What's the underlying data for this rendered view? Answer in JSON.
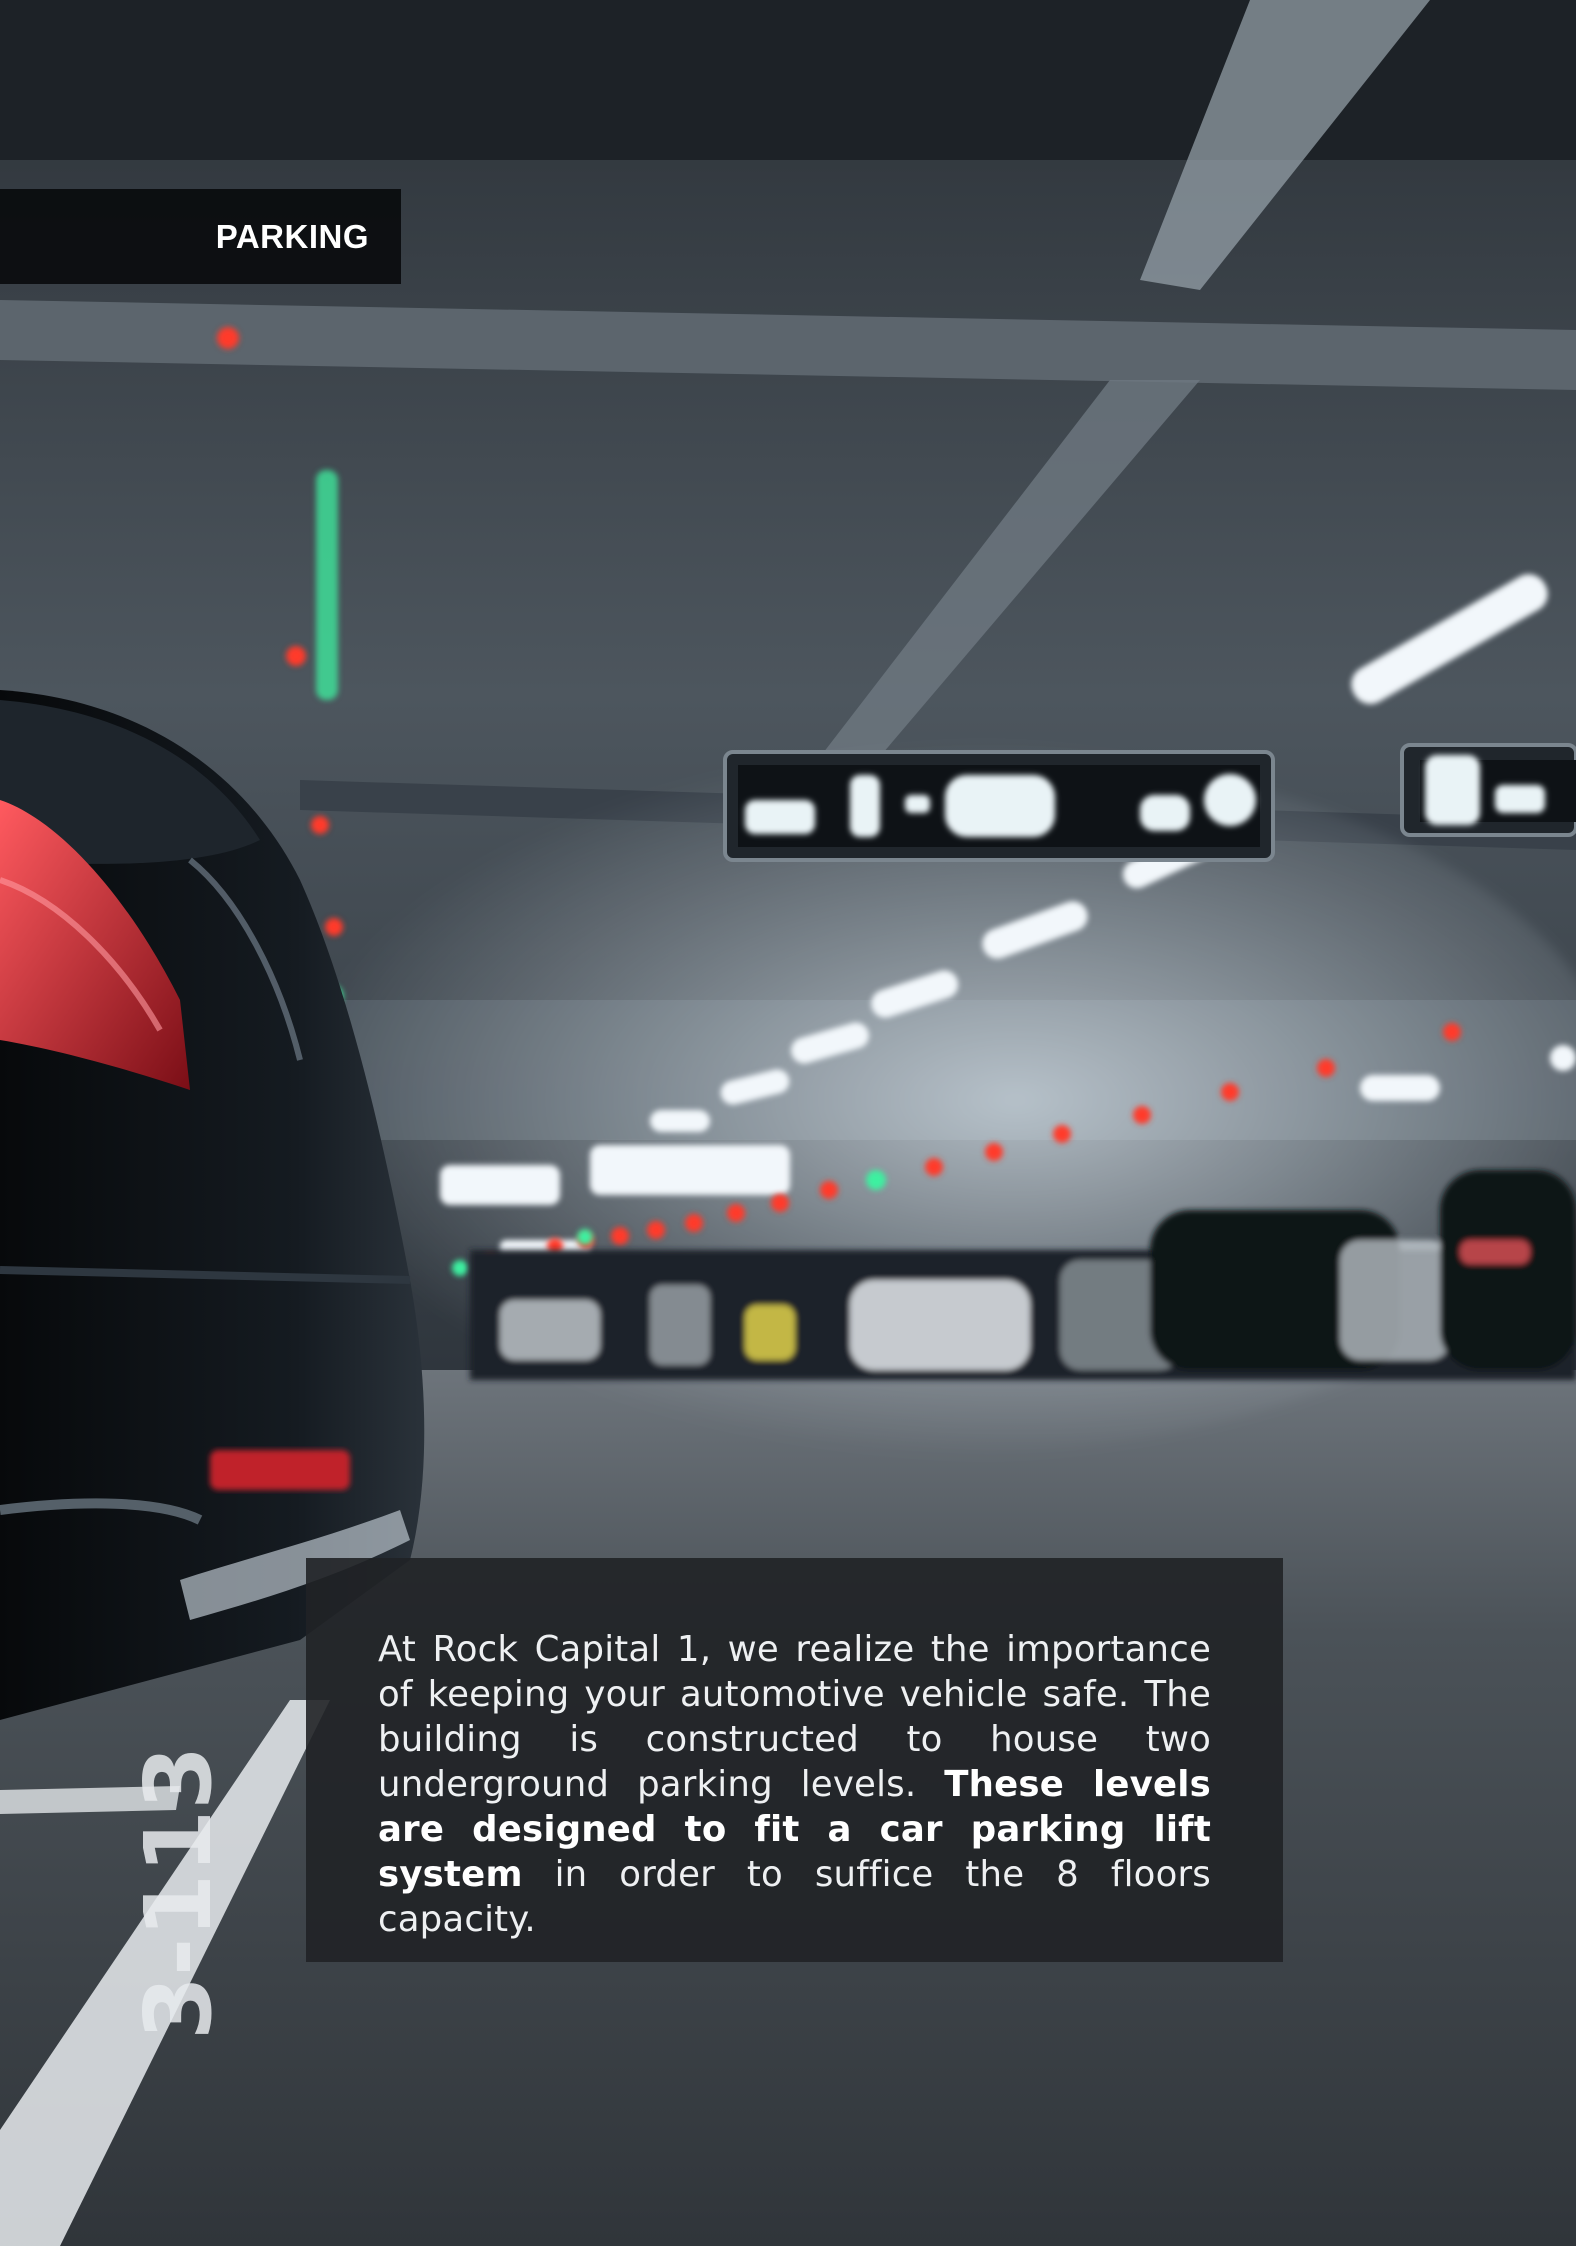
{
  "page": {
    "section_label": "PARKING",
    "body": {
      "lead": "At Rock Capital 1, we realize the importance of keeping your automotive vehicle safe. The building is constructed to house two underground parking levels.",
      "emphasis": "These levels are designed to fit a car parking lift system",
      "tail": "in order to suffice the 8 floors capacity."
    }
  },
  "photo": {
    "subject": "underground parking garage with dark sedan in foreground",
    "floor_marking": "3-113",
    "colors": {
      "ceiling": "#4a525a",
      "floor": "#3a3f45",
      "car": "#0c1014",
      "taillight": "#d8303a",
      "indicator_red": "#ff3a2a",
      "indicator_green": "#3cf0a0",
      "light": "#f2f7fb"
    }
  }
}
